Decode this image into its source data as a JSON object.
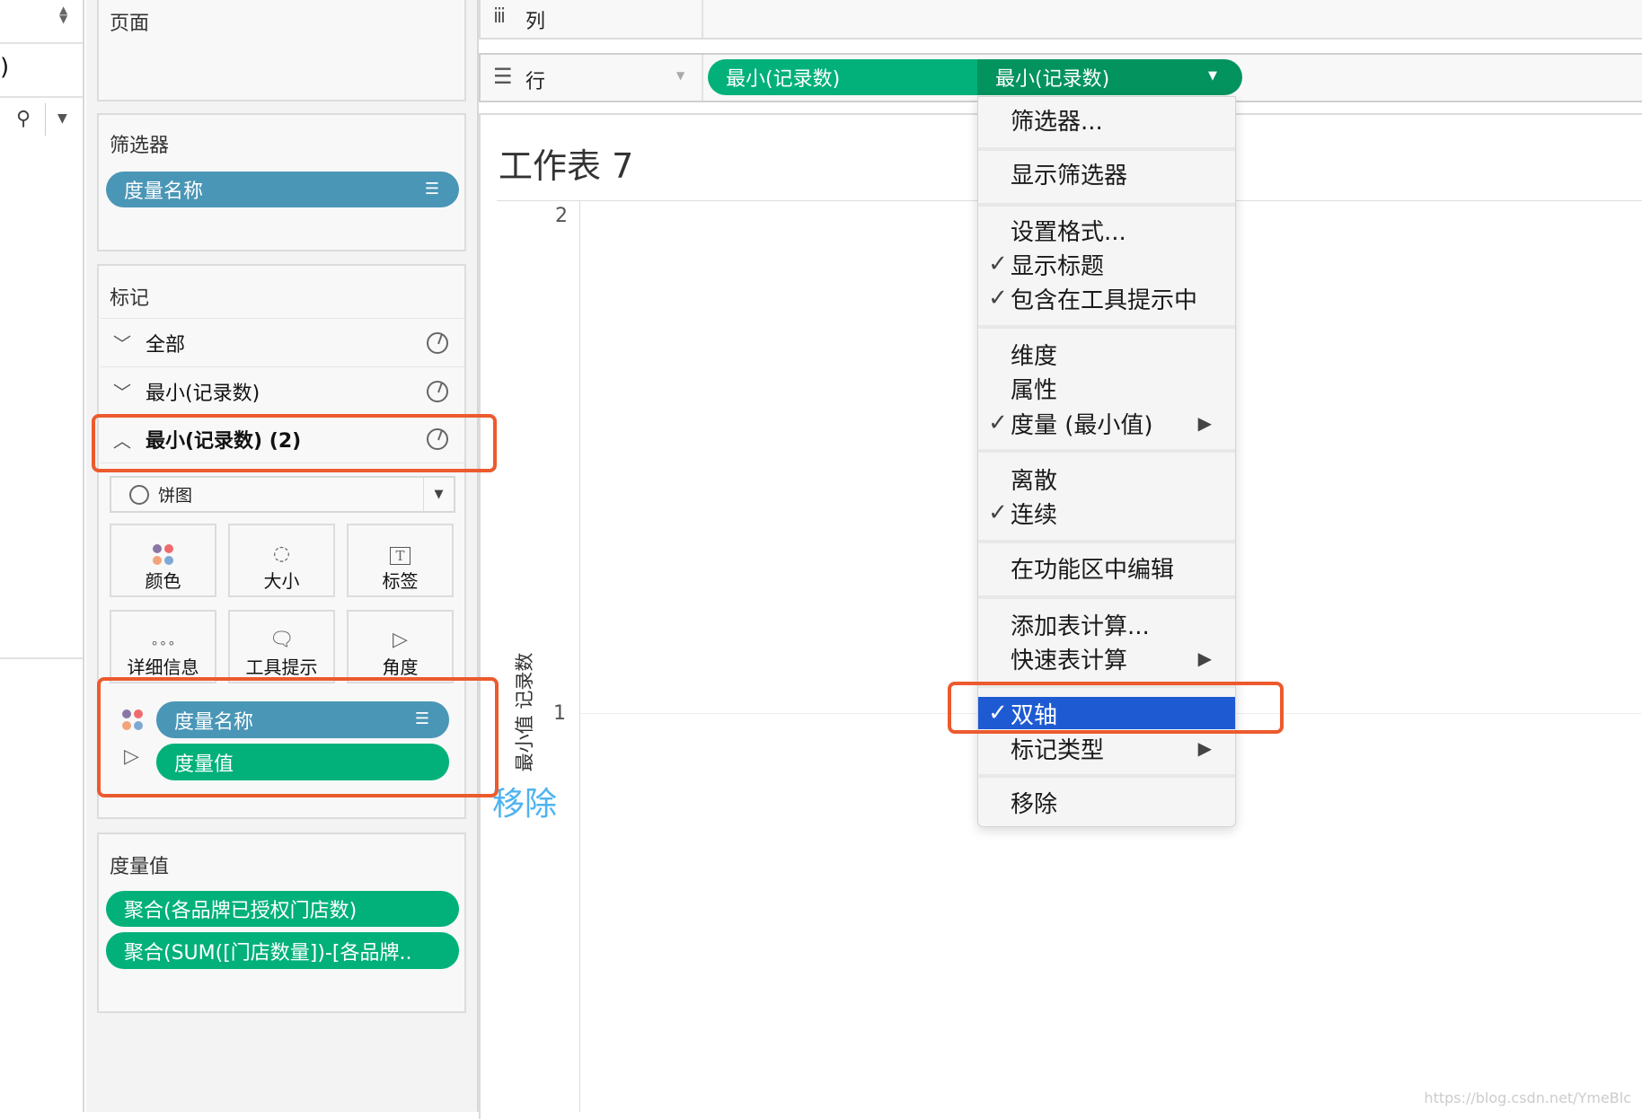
{
  "left_strip": {
    "paren": ")"
  },
  "pages": {
    "title": "页面"
  },
  "filters": {
    "title": "筛选器",
    "pill": "度量名称"
  },
  "marks": {
    "title": "标记",
    "rows": [
      {
        "label": "全部",
        "expanded": false
      },
      {
        "label": "最小(记录数)",
        "expanded": false
      },
      {
        "label": "最小(记录数) (2)",
        "expanded": true
      }
    ],
    "mark_type": "饼图",
    "buttons": [
      "颜色",
      "大小",
      "标签",
      "详细信息",
      "工具提示",
      "角度"
    ],
    "pills": [
      {
        "label": "度量名称",
        "encoding": "color"
      },
      {
        "label": "度量值",
        "encoding": "angle"
      }
    ]
  },
  "measure_values": {
    "title": "度量值",
    "pills": [
      "聚合(各品牌已授权门店数)",
      "聚合(SUM([门店数量])-[各品牌.."
    ]
  },
  "shelves": {
    "columns_label": "列",
    "rows_label": "行",
    "row_pills": [
      "最小(记录数)",
      "最小(记录数)"
    ]
  },
  "sheet": {
    "title": "工作表 7",
    "axis_title": "最小值 记录数",
    "ticks": [
      "2",
      "1"
    ]
  },
  "drag_hint": "移除",
  "menu": {
    "items": [
      {
        "label": "筛选器...",
        "checked": false
      },
      {
        "label": "显示筛选器",
        "checked": false
      },
      {
        "label": "设置格式...",
        "checked": false
      },
      {
        "label": "显示标题",
        "checked": true
      },
      {
        "label": "包含在工具提示中",
        "checked": true
      },
      {
        "label": "维度",
        "checked": false
      },
      {
        "label": "属性",
        "checked": false
      },
      {
        "label": "度量 (最小值)",
        "checked": true,
        "submenu": true
      },
      {
        "label": "离散",
        "checked": false
      },
      {
        "label": "连续",
        "checked": true
      },
      {
        "label": "在功能区中编辑",
        "checked": false
      },
      {
        "label": "添加表计算...",
        "checked": false
      },
      {
        "label": "快速表计算",
        "checked": false,
        "submenu": true
      },
      {
        "label": "双轴",
        "checked": true,
        "highlighted": true
      },
      {
        "label": "标记类型",
        "checked": false,
        "submenu": true
      },
      {
        "label": "移除",
        "checked": false
      }
    ],
    "check_glyph": "✓",
    "submenu_glyph": "▶"
  },
  "watermark": "https://blog.csdn.net/YmeBlc",
  "colors": {
    "blue_pill": "#4a96b6",
    "green_pill": "#02b17a",
    "dark_green_pill": "#02935f",
    "highlight": "#1e5bd3",
    "annotation": "#ec5a2e",
    "hint": "#4fb3f0"
  }
}
